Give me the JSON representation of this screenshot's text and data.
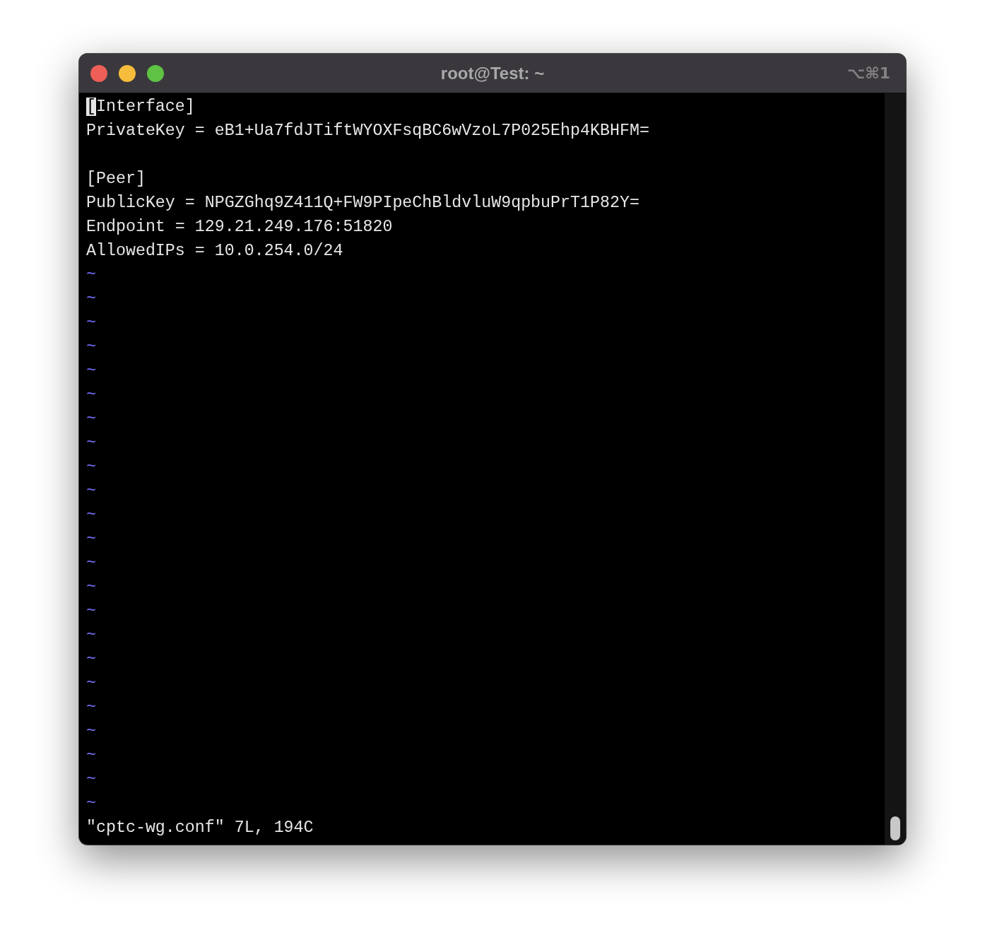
{
  "window": {
    "title": "root@Test: ~",
    "shortcut": "⌥⌘1"
  },
  "buffer_lines": [
    {
      "text": "[Interface]",
      "cursor": true
    },
    {
      "text": "PrivateKey = eB1+Ua7fdJTiftWYOXFsqBC6wVzoL7P025Ehp4KBHFM=",
      "cursor": false
    },
    {
      "cursor": false
    },
    {
      "text": "[Peer]",
      "cursor": false
    },
    {
      "text": "PublicKey = NPGZGhq9Z411Q+FW9PIpeChBldvluW9qpbuPrT1P82Y=",
      "cursor": false
    },
    {
      "text": "Endpoint = 129.21.249.176:51820",
      "cursor": false
    },
    {
      "text": "AllowedIPs = 10.0.254.0/24",
      "cursor": false
    }
  ],
  "empty_line_markers": [
    "~",
    "~",
    "~",
    "~",
    "~",
    "~",
    "~",
    "~",
    "~",
    "~",
    "~",
    "~",
    "~",
    "~",
    "~",
    "~",
    "~",
    "~",
    "~",
    "~",
    "~",
    "~",
    "~"
  ],
  "status_line": "\"cptc-wg.conf\" 7L, 194C"
}
